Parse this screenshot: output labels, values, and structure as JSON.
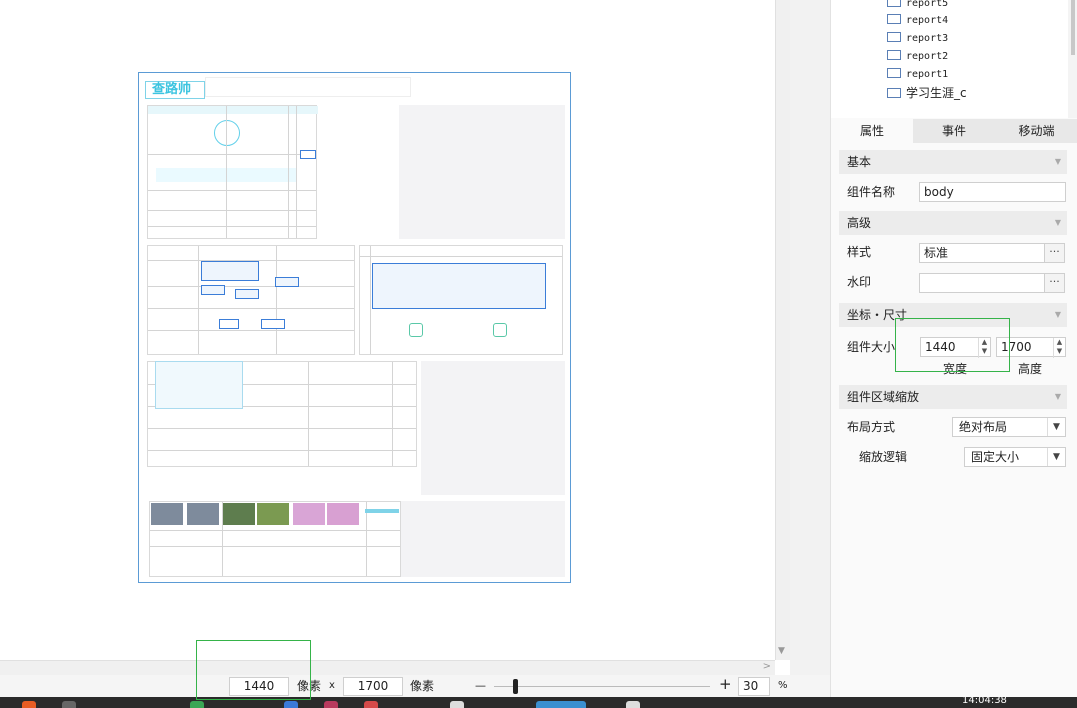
{
  "canvas": {
    "mini_title": "查路帅"
  },
  "tree": {
    "items": [
      "report5",
      "report4",
      "report3",
      "report2",
      "report1",
      "学习生涯_c"
    ]
  },
  "tabs": [
    "属性",
    "事件",
    "移动端"
  ],
  "sections": {
    "basic": "基本",
    "advanced": "高级",
    "coords": "坐标・尺寸",
    "zone_scale": "组件区域缩放"
  },
  "props": {
    "component_name_label": "组件名称",
    "component_name_value": "body",
    "style_label": "样式",
    "style_value": "标准",
    "watermark_label": "水印",
    "watermark_value": "",
    "size_label": "组件大小",
    "width_value": "1440",
    "height_value": "1700",
    "width_caption": "宽度",
    "height_caption": "高度",
    "layout_label": "布局方式",
    "layout_value": "绝对布局",
    "scale_label": "缩放逻辑",
    "scale_value": "固定大小",
    "dots": "···"
  },
  "statusbar": {
    "width_value": "1440",
    "unit1": "像素",
    "times": "x",
    "height_value": "1700",
    "unit2": "像素",
    "minus": "—",
    "plus": "+",
    "zoom_value": "30",
    "percent": "%"
  },
  "taskbar": {
    "clock": "14:04:38"
  },
  "colors": {
    "highlight": "#35b349",
    "frame_border": "#5b9bd5",
    "accent_cyan": "#3cc4e0"
  },
  "icons": {
    "chevron": "chevron-down-icon",
    "spin": "spin-arrows-icon",
    "more": "more-dots-icon"
  }
}
